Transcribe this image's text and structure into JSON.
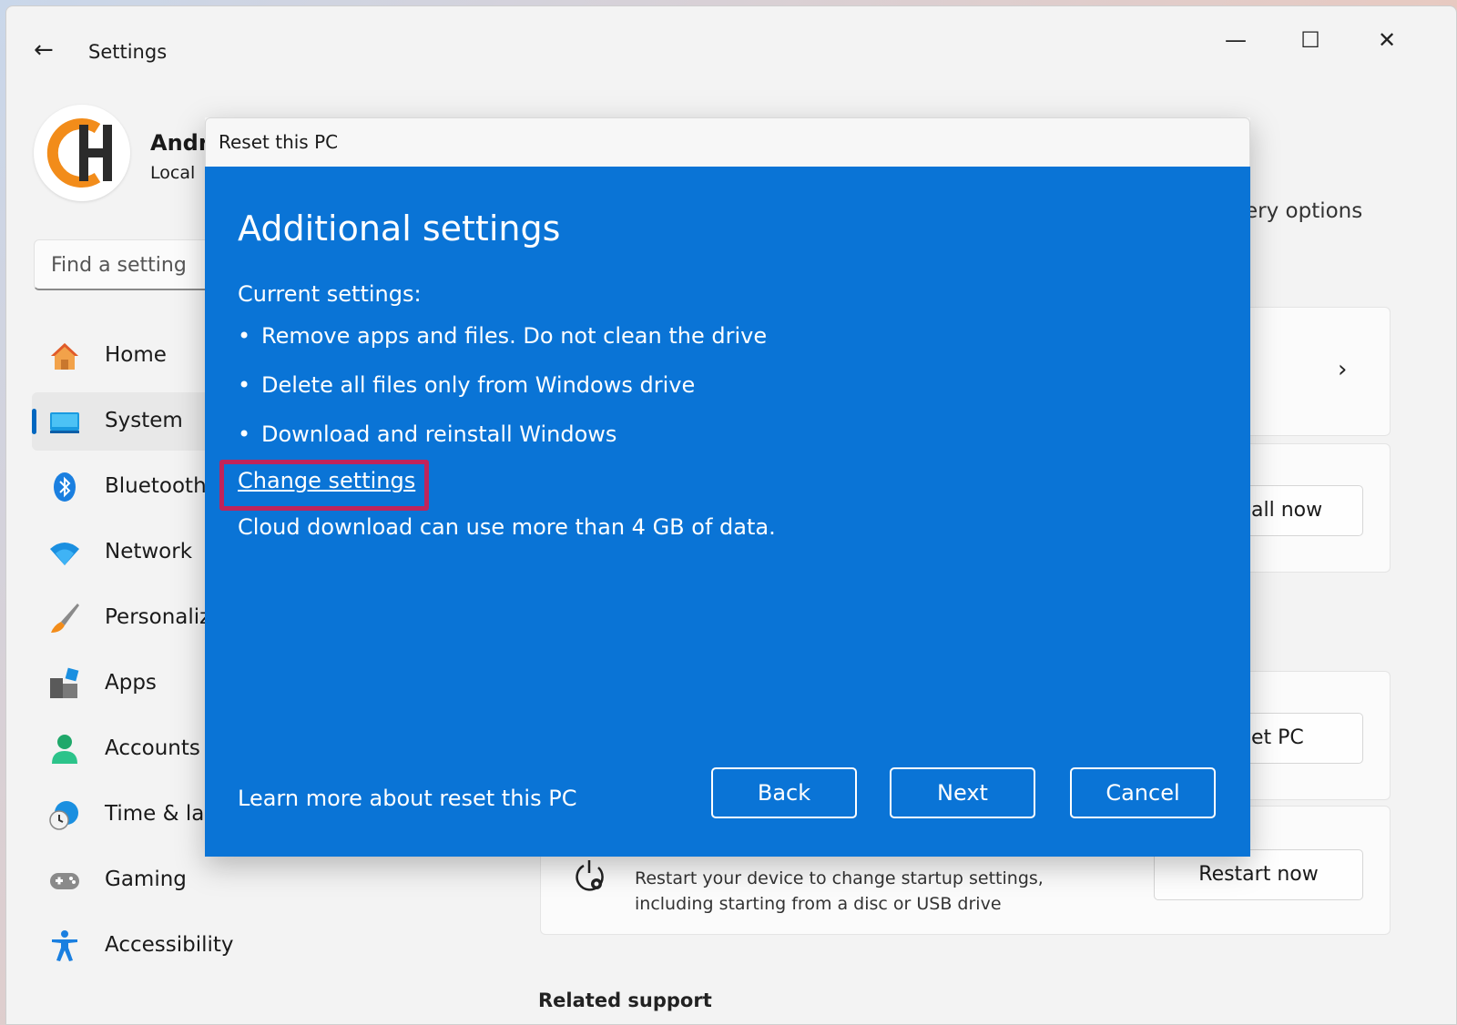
{
  "window": {
    "title": "Settings",
    "controls": {
      "minimize": "—",
      "maximize": "☐",
      "close": "✕"
    }
  },
  "profile": {
    "name": "Andr",
    "subtitle": "Local"
  },
  "search": {
    "placeholder": "Find a setting"
  },
  "sidebar": {
    "items": [
      {
        "label": "Home",
        "icon": "home-icon"
      },
      {
        "label": "System",
        "icon": "system-icon",
        "active": true
      },
      {
        "label": "Bluetooth",
        "icon": "bluetooth-icon"
      },
      {
        "label": "Network",
        "icon": "wifi-icon"
      },
      {
        "label": "Personaliz",
        "icon": "brush-icon"
      },
      {
        "label": "Apps",
        "icon": "apps-icon"
      },
      {
        "label": "Accounts",
        "icon": "person-icon"
      },
      {
        "label": "Time & la",
        "icon": "clock-icon"
      },
      {
        "label": "Gaming",
        "icon": "gamepad-icon"
      },
      {
        "label": "Accessibility",
        "icon": "accessibility-icon"
      }
    ]
  },
  "background": {
    "recovery_label": "ery options",
    "reinstall_button": "all now",
    "reset_button": "et PC",
    "restart_button": "Restart now",
    "restart_description": "Restart your device to change startup settings, including starting from a disc or USB drive",
    "related_heading": "Related support"
  },
  "dialog": {
    "title": "Reset this PC",
    "heading": "Additional settings",
    "current_label": "Current settings:",
    "bullets": [
      "Remove apps and files. Do not clean the drive",
      "Delete all files only from Windows drive",
      "Download and reinstall Windows"
    ],
    "change_link": "Change settings",
    "cloud_note": "Cloud download can use more than 4 GB of data.",
    "learn_link": "Learn more about reset this PC",
    "buttons": {
      "back": "Back",
      "next": "Next",
      "cancel": "Cancel"
    }
  },
  "colors": {
    "dialog_blue": "#0a74d6",
    "highlight": "#c0245a",
    "accent": "#0067c0"
  }
}
